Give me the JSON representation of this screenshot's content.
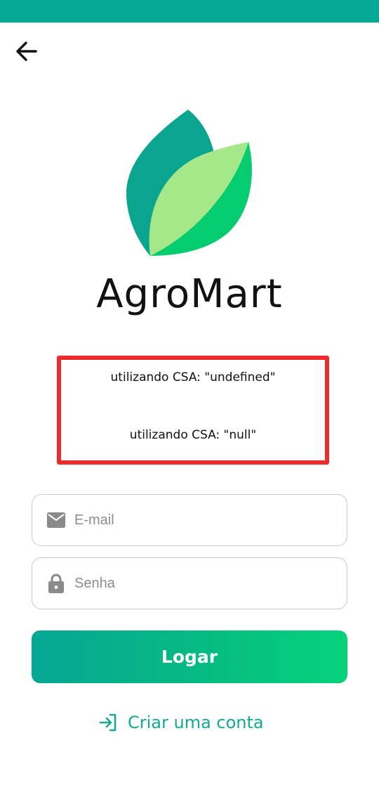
{
  "app": {
    "title": "AgroMart"
  },
  "colors": {
    "status_bar": "#03a893",
    "accent": "#15a893",
    "leaf_dark": "#0aa58f",
    "leaf_light": "#a4e88a",
    "leaf_green": "#06cc70",
    "debug_border": "#ee2b2b"
  },
  "header": {
    "back_icon": "arrow-left-icon"
  },
  "logo": {
    "icon": "leaf-logo-icon"
  },
  "debug": {
    "line1": "utilizando CSA: \"undefined\"",
    "line2": "utilizando CSA: \"null\""
  },
  "form": {
    "email": {
      "placeholder": "E-mail",
      "value": "",
      "icon": "envelope-icon"
    },
    "password": {
      "placeholder": "Senha",
      "value": "",
      "icon": "lock-icon"
    },
    "login_label": "Logar",
    "create_account_label": "Criar uma conta",
    "create_account_icon": "login-arrow-icon"
  }
}
